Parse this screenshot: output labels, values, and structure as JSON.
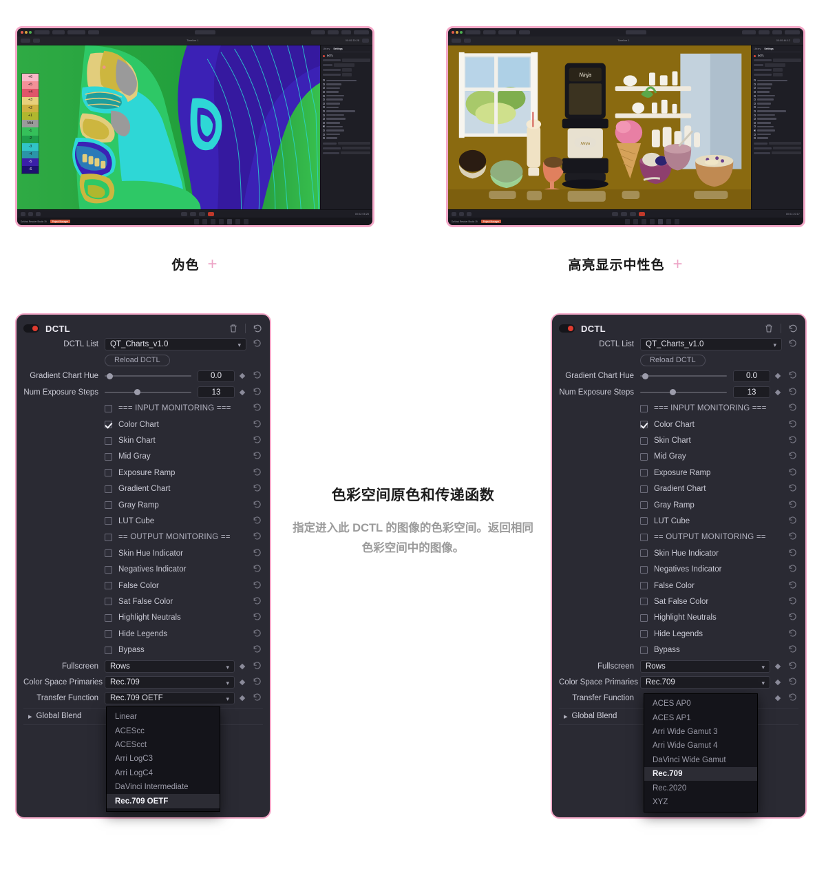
{
  "captions": {
    "left": "伪色",
    "right": "高亮显示中性色",
    "plus": "+"
  },
  "center": {
    "title": "色彩空间原色和传递函数",
    "body": "指定进入此 DCTL 的图像的色彩空间。返回相同色彩空间中的图像。"
  },
  "screenshots": {
    "left": {
      "app_name": "DaVinci Resolve Studio 19",
      "project_name": "Timeline 1",
      "timecode_left": "00:00:30:28",
      "timecode_right": "00:02:05:28",
      "status_badge": "Project Manager",
      "nav_items": [
        "Media",
        "Cut",
        "Edit",
        "Fusion",
        "Color",
        "Fairlight",
        "Deliver"
      ],
      "inspector_tabs": [
        "Library",
        "Settings"
      ],
      "inspector_node": "DCTL",
      "false_color_legend": [
        "+6",
        "+5",
        "+4",
        "+3",
        "+2",
        "+1",
        "Mid",
        "-1",
        "-2",
        "-3",
        "-4",
        "-5",
        "-6"
      ],
      "false_color_swatches": [
        "#f9b8c8",
        "#f39098",
        "#e0556a",
        "#e8d07c",
        "#cfb040",
        "#b0b72e",
        "#9b9b9b",
        "#35c05a",
        "#1f9e4a",
        "#31c4c8",
        "#2a95a8",
        "#3a1fa8",
        "#1d1070"
      ]
    },
    "right": {
      "app_name": "DaVinci Resolve Studio 19",
      "project_name": "Timeline 1",
      "timecode_left": "00:00:44:12",
      "timecode_right": "00:01:20:17",
      "status_badge": "Project Manager",
      "nav_items": [
        "Media",
        "Cut",
        "Edit",
        "Fusion",
        "Color",
        "Fairlight",
        "Deliver"
      ],
      "inspector_tabs": [
        "Library",
        "Settings"
      ],
      "inspector_node": "DCTL",
      "neutral_overlay_color": "#8a6a10"
    }
  },
  "dctl_panel": {
    "title": "DCTL",
    "toggle_on": true,
    "trash_icon": "trash-icon",
    "reset_icon": "reset-icon",
    "dctl_list": {
      "label": "DCTL List",
      "value": "QT_Charts_v1.0"
    },
    "reload_button": "Reload DCTL",
    "sliders": [
      {
        "label": "Gradient Chart Hue",
        "value": "0.0",
        "knob_percent": 2
      },
      {
        "label": "Num Exposure Steps",
        "value": "13",
        "knob_percent": 34
      }
    ],
    "checkboxes": [
      {
        "label": "=== INPUT MONITORING ===",
        "checked": false,
        "header": true
      },
      {
        "label": "Color Chart",
        "checked": true,
        "header": false
      },
      {
        "label": "Skin Chart",
        "checked": false,
        "header": false
      },
      {
        "label": "Mid Gray",
        "checked": false,
        "header": false
      },
      {
        "label": "Exposure Ramp",
        "checked": false,
        "header": false
      },
      {
        "label": "Gradient Chart",
        "checked": false,
        "header": false
      },
      {
        "label": "Gray Ramp",
        "checked": false,
        "header": false
      },
      {
        "label": "LUT Cube",
        "checked": false,
        "header": false
      },
      {
        "label": "== OUTPUT MONITORING ==",
        "checked": false,
        "header": true
      },
      {
        "label": "Skin Hue Indicator",
        "checked": false,
        "header": false
      },
      {
        "label": "Negatives Indicator",
        "checked": false,
        "header": false
      },
      {
        "label": "False Color",
        "checked": false,
        "header": false
      },
      {
        "label": "Sat False Color",
        "checked": false,
        "header": false
      },
      {
        "label": "Highlight Neutrals",
        "checked": false,
        "header": false
      },
      {
        "label": "Hide Legends",
        "checked": false,
        "header": false
      },
      {
        "label": "Bypass",
        "checked": false,
        "header": false
      }
    ],
    "selects": [
      {
        "label": "Fullscreen",
        "value": "Rows"
      },
      {
        "label": "Color Space Primaries",
        "value": "Rec.709"
      },
      {
        "label": "Transfer Function",
        "value": "Rec.709 OETF"
      }
    ],
    "global_blend": "Global Blend"
  },
  "dropdowns": {
    "transfer_function": {
      "options": [
        "Linear",
        "ACEScc",
        "ACEScct",
        "Arri LogC3",
        "Arri LogC4",
        "DaVinci Intermediate",
        "Rec.709 OETF"
      ],
      "selected": "Rec.709 OETF"
    },
    "color_space_primaries": {
      "options": [
        "ACES AP0",
        "ACES AP1",
        "Arri Wide Gamut 3",
        "Arri Wide Gamut 4",
        "DaVinci Wide Gamut",
        "Rec.709",
        "Rec.2020",
        "XYZ"
      ],
      "selected": "Rec.709"
    }
  },
  "colors": {
    "accent_pink": "#f4a8c8",
    "panel_bg": "#2a2a33",
    "dropdown_bg": "#14141a",
    "neutral_gold": "#8a6a10"
  }
}
